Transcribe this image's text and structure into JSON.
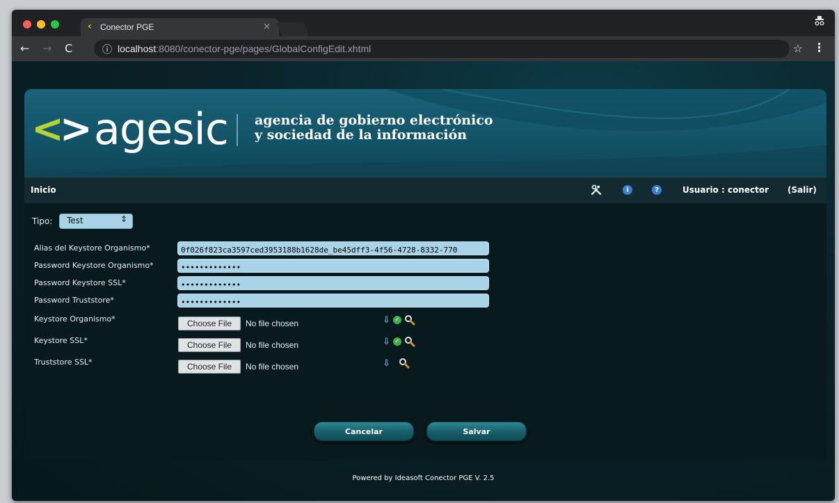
{
  "browser": {
    "tab_title": "Conector PGE",
    "tab_close": "×",
    "url_host": "localhost",
    "url_rest": ":8080/conector-pge/pages/GlobalConfigEdit.xhtml"
  },
  "header": {
    "logo_left": "<",
    "logo_right": ">",
    "logo_word": "agesic",
    "tagline_line1": "agencia de gobierno electrónico",
    "tagline_line2": "y sociedad de la información"
  },
  "nav": {
    "home": "Inicio",
    "user": "Usuario : conector",
    "logout": "(Salir)"
  },
  "form": {
    "tipo_label": "Tipo:",
    "tipo_value": "Test",
    "fields": [
      {
        "label": "Alias del Keystore Organismo*",
        "value": "0f026f823ca3597ced3953188b1628de_be45dff3-4f56-4728-8332-770"
      },
      {
        "label": "Password Keystore Organismo*",
        "value": "•••••••••••••"
      },
      {
        "label": "Password Keystore SSL*",
        "value": "•••••••••••••"
      },
      {
        "label": "Password Truststore*",
        "value": "•••••••••••••"
      }
    ],
    "files": [
      {
        "label": "Keystore Organismo*",
        "button": "Choose File",
        "status": "No file chosen"
      },
      {
        "label": "Keystore SSL*",
        "button": "Choose File",
        "status": "No file chosen"
      },
      {
        "label": "Truststore SSL*",
        "button": "Choose File",
        "status": "No file chosen"
      }
    ],
    "cancel": "Cancelar",
    "save": "Salvar"
  },
  "footer": "Powered by Ideasoft Conector PGE V. 2.5",
  "colors": {
    "logo_accent": "#b4d334",
    "field_bg": "#a9d3e6",
    "button": "#17606c"
  }
}
